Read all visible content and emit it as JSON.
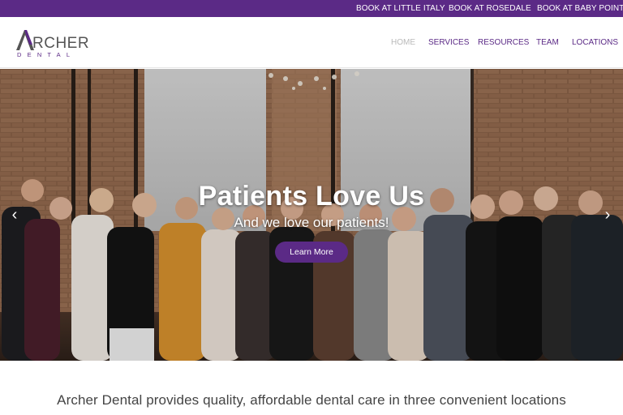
{
  "topbar": {
    "links": [
      "BOOK AT LITTLE ITALY",
      "BOOK AT ROSEDALE",
      "BOOK AT BABY POINT"
    ]
  },
  "header": {
    "logo_main": "RCHER",
    "logo_sub": "DENTAL",
    "nav": [
      "HOME",
      "SERVICES",
      "RESOURCES",
      "TEAM",
      "LOCATIONS"
    ],
    "active_nav": "HOME"
  },
  "hero": {
    "title": "Patients Love Us",
    "subtitle": "And we love our patients!",
    "cta_label": "Learn More",
    "prev_glyph": "‹",
    "next_glyph": "›"
  },
  "intro": {
    "text": "Archer Dental provides quality, affordable dental care in three convenient locations"
  },
  "colors": {
    "brand_purple": "#5b2a86",
    "nav_inactive": "#b9b9b9",
    "text_dark": "#444444"
  },
  "icons": {
    "logo": "archer-a-icon",
    "prev": "chevron-left-icon",
    "next": "chevron-right-icon"
  }
}
